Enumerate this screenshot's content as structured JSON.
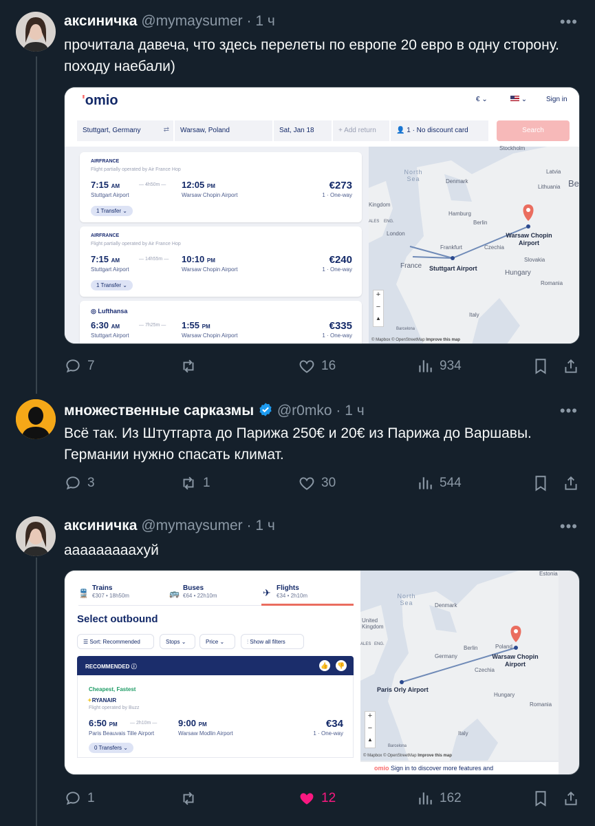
{
  "tweets": [
    {
      "name": "аксиничка",
      "handle": "@mymaysumer",
      "sep": "·",
      "time": "1 ч",
      "text": "прочитала давеча, что здесь перелеты по европе 20 евро в одну сторону. походу наебали)",
      "replies": "7",
      "retweets": "",
      "likes": "16",
      "views": "934"
    },
    {
      "name": "множественные сарказмы",
      "handle": "@r0mko",
      "sep": "·",
      "time": "1 ч",
      "text": "Всё так. Из Штутгарта до Парижа 250€ и 20€ из Парижа до Варшавы. Германии нужно спасать климат.",
      "replies": "3",
      "retweets": "1",
      "likes": "30",
      "views": "544"
    },
    {
      "name": "аксиничка",
      "handle": "@mymaysumer",
      "sep": "·",
      "time": "1 ч",
      "text": "аааааааааxуй",
      "replies": "1",
      "retweets": "",
      "likes": "12",
      "views": "162"
    }
  ],
  "more_label": "•••",
  "colors": {
    "bg": "#15202b",
    "muted": "#8b98a5",
    "like_active": "#f91880",
    "verified": "#1d9bf0",
    "omio_navy": "#132968",
    "omio_coral": "#fa6b6b"
  },
  "omio1": {
    "logo": "omio",
    "currency": "€",
    "signin": "Sign in",
    "from": "Stuttgart, Germany",
    "to": "Warsaw, Poland",
    "date": "Sat, Jan 18",
    "add_return": "+ Add return",
    "pax": "1 · No discount card",
    "search": "Search",
    "results": [
      {
        "airline": "AIRFRANCE",
        "note": "Flight partially operated by Air France Hop",
        "dep": "7:15",
        "dep_ampm": "AM",
        "dur": "4h50m",
        "arr": "12:05",
        "arr_ampm": "PM",
        "from": "Stuttgart Airport",
        "to": "Warsaw Chopin Airport",
        "price": "€273",
        "pax": "1 · One-way",
        "transfer": "1 Transfer"
      },
      {
        "airline": "AIRFRANCE",
        "note": "Flight partially operated by Air France Hop",
        "dep": "7:15",
        "dep_ampm": "AM",
        "dur": "14h55m",
        "arr": "10:10",
        "arr_ampm": "PM",
        "from": "Stuttgart Airport",
        "to": "Warsaw Chopin Airport",
        "price": "€240",
        "pax": "1 · One-way",
        "transfer": "1 Transfer"
      },
      {
        "airline": "Lufthansa",
        "note": "",
        "dep": "6:30",
        "dep_ampm": "AM",
        "dur": "7h25m",
        "arr": "1:55",
        "arr_ampm": "PM",
        "from": "Stuttgart Airport",
        "to": "Warsaw Chopin Airport",
        "price": "€335",
        "pax": "1 · One-way",
        "transfer": ""
      }
    ],
    "map": {
      "labels": [
        "Stockholm",
        "North Sea",
        "Denmark",
        "Latvia",
        "Lithuania",
        "Kingdom",
        "Hamburg",
        "Berlin",
        "London",
        "Frankfurt",
        "Czechia",
        "Slovakia",
        "France",
        "Hungary",
        "Romania",
        "Italy",
        "Barcelona",
        "Be",
        "ALES",
        "ENG."
      ],
      "warsaw": "Warsaw Chopin Airport",
      "stuttgart": "Stuttgart Airport",
      "attribution": "© Mapbox © OpenStreetMap",
      "improve": "Improve this map"
    }
  },
  "omio2": {
    "tabs": [
      {
        "label": "Trains",
        "sub": "€307 • 18h50m"
      },
      {
        "label": "Buses",
        "sub": "€64 • 22h10m"
      },
      {
        "label": "Flights",
        "sub": "€34 • 2h10m"
      }
    ],
    "title": "Select outbound",
    "filters": [
      "Sort: Recommended",
      "Stops",
      "Price",
      "Show all filters"
    ],
    "recommended": "RECOMMENDED",
    "badge": "Cheapest, Fastest",
    "airline": "RYANAIR",
    "note": "Flight operated by Buzz",
    "dep": "6:50",
    "dep_ampm": "PM",
    "dur": "2h10m",
    "arr": "9:00",
    "arr_ampm": "PM",
    "from": "Paris Beauvais Tille Airport",
    "to": "Warsaw Modlin Airport",
    "price": "€34",
    "pax": "1 · One-way",
    "transfer": "0 Transfers",
    "map": {
      "labels": [
        "Estonia",
        "North Sea",
        "Denmark",
        "United Kingdom",
        "Germany",
        "Berlin",
        "Poland",
        "Czechia",
        "Hungary",
        "Romania",
        "Italy",
        "Barcelona",
        "ALES",
        "ENG."
      ],
      "warsaw": "Warsaw Chopin Airport",
      "paris": "Paris Orly Airport",
      "attribution": "© Mapbox © OpenStreetMap",
      "improve": "Improve this map"
    },
    "footer": "Sign in to discover more features and"
  }
}
